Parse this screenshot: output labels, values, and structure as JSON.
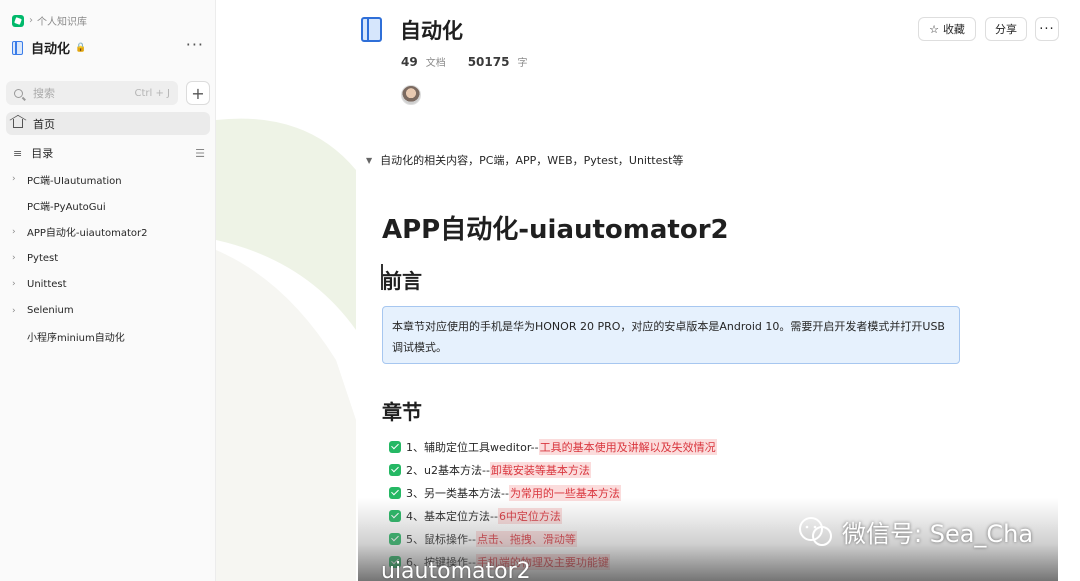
{
  "sidebar": {
    "breadcrumb_sep": "›",
    "breadcrumb": "个人知识库",
    "book_title": "自动化",
    "lock_glyph": "🔒",
    "more": "···",
    "search_placeholder": "搜索",
    "search_shortcut": "Ctrl + J",
    "add": "+",
    "home": "首页",
    "toc": "目录",
    "toc_glyph": "≡",
    "toc_right_glyph": "☰",
    "tree": [
      {
        "label": "PC端-UIautumation",
        "expandable": true
      },
      {
        "label": "PC端-PyAutoGui",
        "expandable": false
      },
      {
        "label": "APP自动化-uiautomator2",
        "expandable": true
      },
      {
        "label": "Pytest",
        "expandable": true
      },
      {
        "label": "Unittest",
        "expandable": true
      },
      {
        "label": "Selenium",
        "expandable": true
      },
      {
        "label": "小程序minium自动化",
        "expandable": false
      }
    ],
    "chevron": "›"
  },
  "header": {
    "title": "自动化",
    "doc_count": "49",
    "doc_unit": "文档",
    "word_count": "50175",
    "word_unit": "字",
    "fav_star": "☆",
    "fav_label": "收藏",
    "share_label": "分享",
    "more": "···"
  },
  "content": {
    "summary_toggle": "▼",
    "summary": "自动化的相关内容，PC端，APP，WEB，Pytest，Unittest等",
    "h1": "APP自动化-uiautomator2",
    "h2_preface": "前言",
    "callout": "本章节对应使用的手机是华为HONOR 20 PRO，对应的安卓版本是Android 10。需要开启开发者模式并打开USB调试模式。",
    "h2_chapters": "章节",
    "tasks": [
      {
        "prefix": "1、辅助定位工具weditor--",
        "highlight": "工具的基本使用及讲解以及失效情况"
      },
      {
        "prefix": "2、u2基本方法--",
        "highlight": "卸载安装等基本方法"
      },
      {
        "prefix": "3、另一类基本方法--",
        "highlight": "为常用的一些基本方法"
      },
      {
        "prefix": "4、基本定位方法--",
        "highlight": "6中定位方法"
      },
      {
        "prefix": "5、鼠标操作--",
        "highlight": "点击、拖拽、滑动等"
      },
      {
        "prefix": "6、按键操作--",
        "highlight": "手机端的物理及主要功能键"
      }
    ]
  },
  "overlay": {
    "caption": "uiautomator2",
    "watermark": "微信号: Sea_Cha"
  },
  "colors": {
    "accent_blue": "#2f6fd8",
    "check_green": "#25b864",
    "highlight_red": "#d9363e",
    "highlight_bg": "#fbdcdc",
    "callout_bg": "#e6f1fd"
  }
}
